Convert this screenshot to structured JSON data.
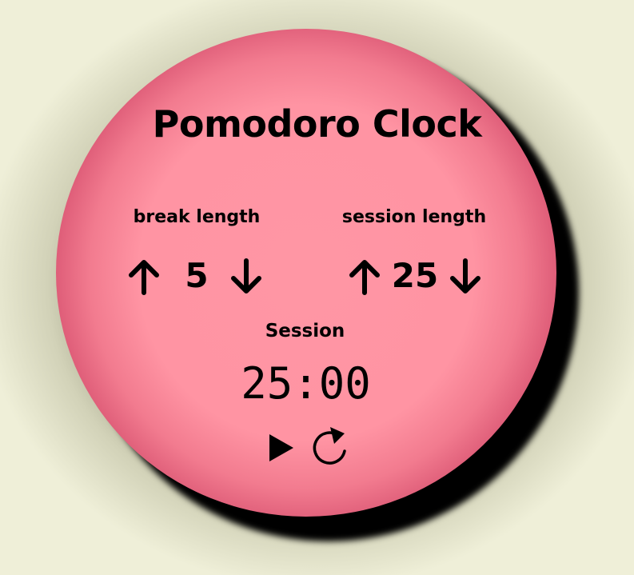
{
  "app": {
    "title": "Pomodoro Clock"
  },
  "break": {
    "label": "break length",
    "value": "5",
    "increment_icon": "arrow-up-icon",
    "decrement_icon": "arrow-down-icon"
  },
  "session": {
    "label": "session length",
    "value": "25",
    "increment_icon": "arrow-up-icon",
    "decrement_icon": "arrow-down-icon"
  },
  "timer": {
    "label": "Session",
    "time": "25:00"
  },
  "controls": {
    "play_icon": "play-icon",
    "reset_icon": "refresh-icon"
  },
  "colors": {
    "background": "#f2f2da",
    "disc_center": "#ff96a4",
    "disc_edge": "#a50f3c",
    "text": "#000000"
  }
}
